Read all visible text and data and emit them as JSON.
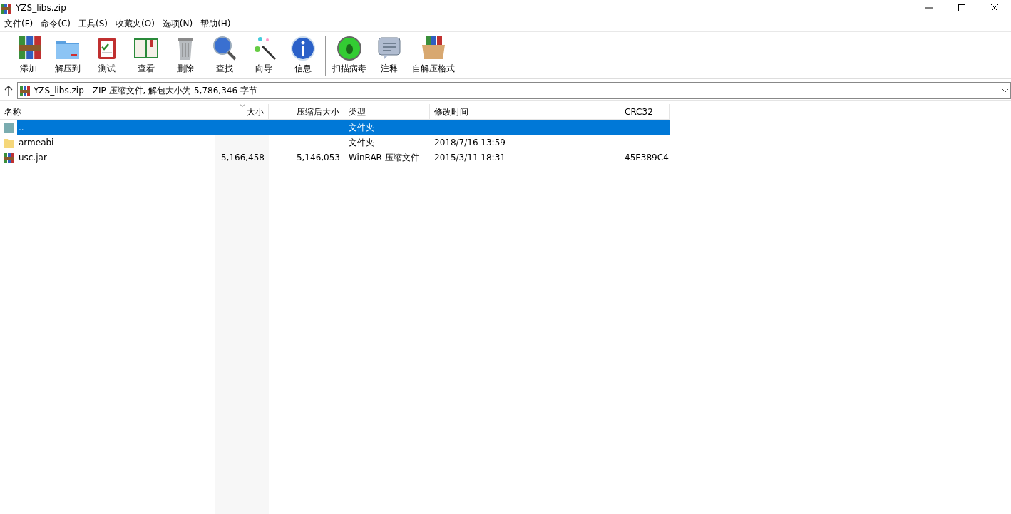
{
  "window": {
    "title": "YZS_libs.zip"
  },
  "menu": [
    "文件(F)",
    "命令(C)",
    "工具(S)",
    "收藏夹(O)",
    "选项(N)",
    "帮助(H)"
  ],
  "toolbar": [
    {
      "label": "添加"
    },
    {
      "label": "解压到"
    },
    {
      "label": "测试"
    },
    {
      "label": "查看"
    },
    {
      "label": "删除"
    },
    {
      "label": "查找"
    },
    {
      "label": "向导"
    },
    {
      "label": "信息"
    },
    {
      "label": "扫描病毒"
    },
    {
      "label": "注释"
    },
    {
      "label": "自解压格式"
    }
  ],
  "address": {
    "value": "YZS_libs.zip - ZIP 压缩文件, 解包大小为 5,786,346 字节"
  },
  "table": {
    "columns": [
      {
        "label": "名称",
        "kind": "text",
        "sorted": false
      },
      {
        "label": "大小",
        "kind": "number",
        "sorted": true
      },
      {
        "label": "压缩后大小",
        "kind": "number",
        "sorted": false
      },
      {
        "label": "类型",
        "kind": "text",
        "sorted": false
      },
      {
        "label": "修改时间",
        "kind": "text",
        "sorted": false
      },
      {
        "label": "CRC32",
        "kind": "text",
        "sorted": false
      }
    ],
    "rows": [
      {
        "kind": "parent",
        "selected": true,
        "cells": [
          "..",
          "",
          "",
          "文件夹",
          "",
          ""
        ]
      },
      {
        "kind": "folder",
        "selected": false,
        "cells": [
          "armeabi",
          "",
          "",
          "文件夹",
          "2018/7/16 13:59",
          ""
        ]
      },
      {
        "kind": "archive",
        "selected": false,
        "cells": [
          "usc.jar",
          "5,166,458",
          "5,146,053",
          "WinRAR 压缩文件",
          "2015/3/11 18:31",
          "45E389C4"
        ]
      }
    ]
  }
}
